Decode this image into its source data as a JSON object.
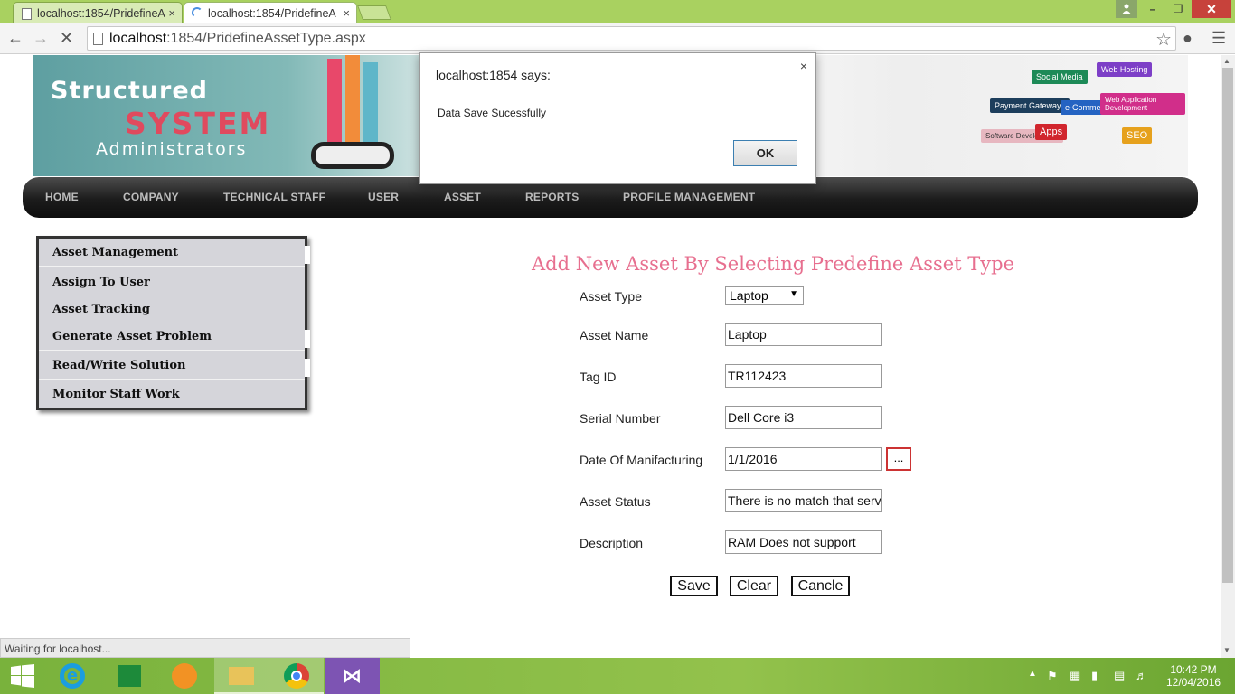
{
  "browser": {
    "tabs": [
      {
        "title": "localhost:1854/PridefineA",
        "close": "×"
      },
      {
        "title": "localhost:1854/PridefineA",
        "close": "×"
      }
    ],
    "url_host": "localhost",
    "url_rest": ":1854/PridefineAssetType.aspx",
    "status": "Waiting for localhost..."
  },
  "banner": {
    "line1": "Structured",
    "line2": "SYSTEM",
    "line3": "Administrators",
    "signs": [
      "Social Media",
      "Web Hosting",
      "Payment Gateways",
      "e-Commerce",
      "Web Application Development",
      "Software Development",
      "Apps",
      "SEO"
    ]
  },
  "nav": [
    "HOME",
    "COMPANY",
    "TECHNICAL STAFF",
    "USER",
    "ASSET",
    "REPORTS",
    "PROFILE MANAGEMENT"
  ],
  "sidebar": [
    "Asset Management",
    "Assign To User",
    "Asset Tracking",
    "Generate Asset Problem",
    "Read/Write Solution",
    "Monitor Staff Work"
  ],
  "form": {
    "title": "Add New Asset By Selecting Predefine Asset Type",
    "labels": {
      "asset_type": "Asset Type",
      "asset_name": "Asset Name",
      "tag_id": "Tag ID",
      "serial_number": "Serial Number",
      "date_of_manufacturing": "Date Of Manifacturing",
      "asset_status": "Asset Status",
      "description": "Description"
    },
    "values": {
      "asset_type": "Laptop",
      "asset_name": "Laptop",
      "tag_id": "TR112423",
      "serial_number": "Dell Core i3",
      "date_of_manufacturing": "1/1/2016",
      "asset_status": "There is no match that serv",
      "description": "RAM Does not support"
    },
    "calendar_button": "...",
    "buttons": {
      "save": "Save",
      "clear": "Clear",
      "cancel": "Cancle"
    }
  },
  "dialog": {
    "title": "localhost:1854 says:",
    "message": "Data Save Sucessfully",
    "ok": "OK",
    "close": "×"
  },
  "taskbar": {
    "time": "10:42 PM",
    "date": "12/04/2016"
  }
}
